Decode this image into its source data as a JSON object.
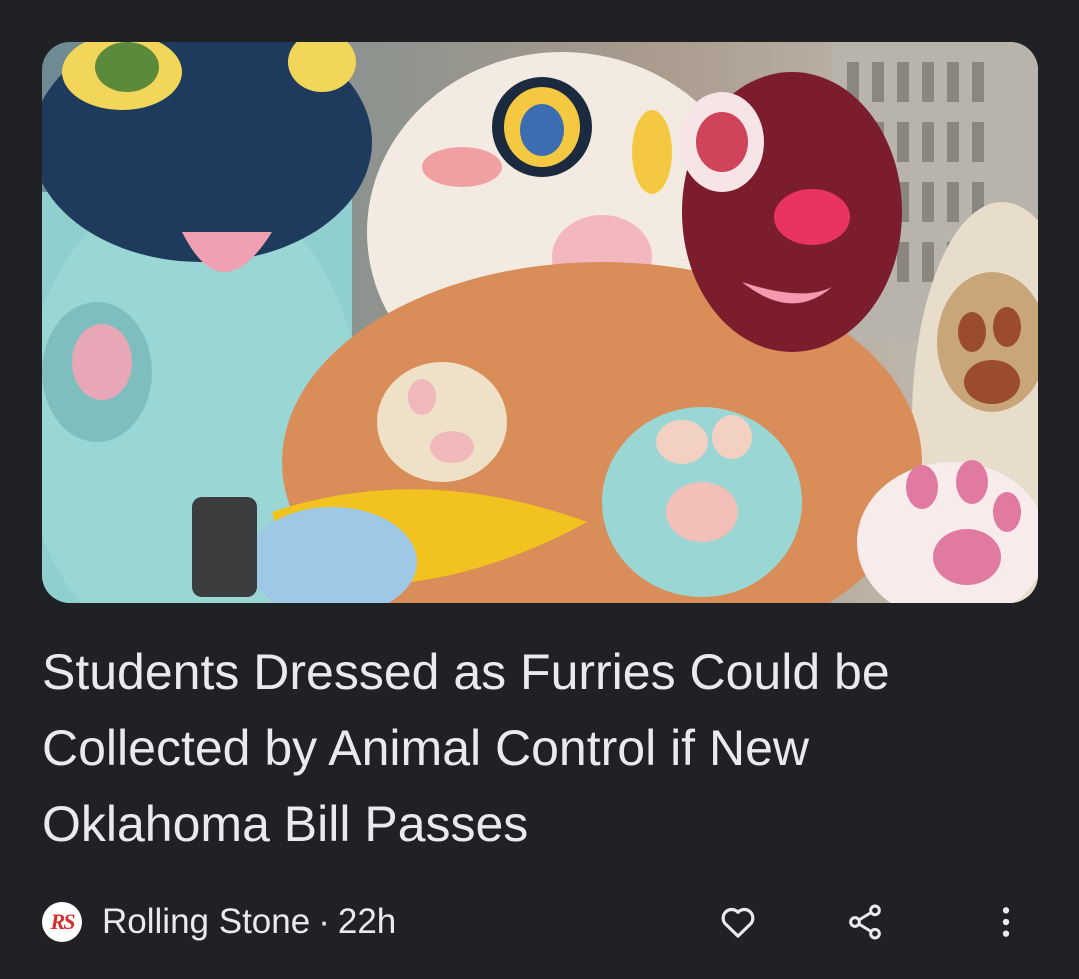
{
  "article": {
    "headline": "Students Dressed as Furries Could be Collected by Animal Control if New Oklahoma Bill Passes",
    "image_alt": "People in colorful furry animal costumes posing",
    "source": {
      "logo_text": "RS",
      "name": "Rolling Stone",
      "separator": "·",
      "age": "22h"
    }
  },
  "actions": {
    "like_icon": "heart-icon",
    "share_icon": "share-icon",
    "more_icon": "more-vert-icon"
  },
  "colors": {
    "background": "#202124",
    "text": "#e8eaed",
    "logo_red": "#d32f2f"
  }
}
